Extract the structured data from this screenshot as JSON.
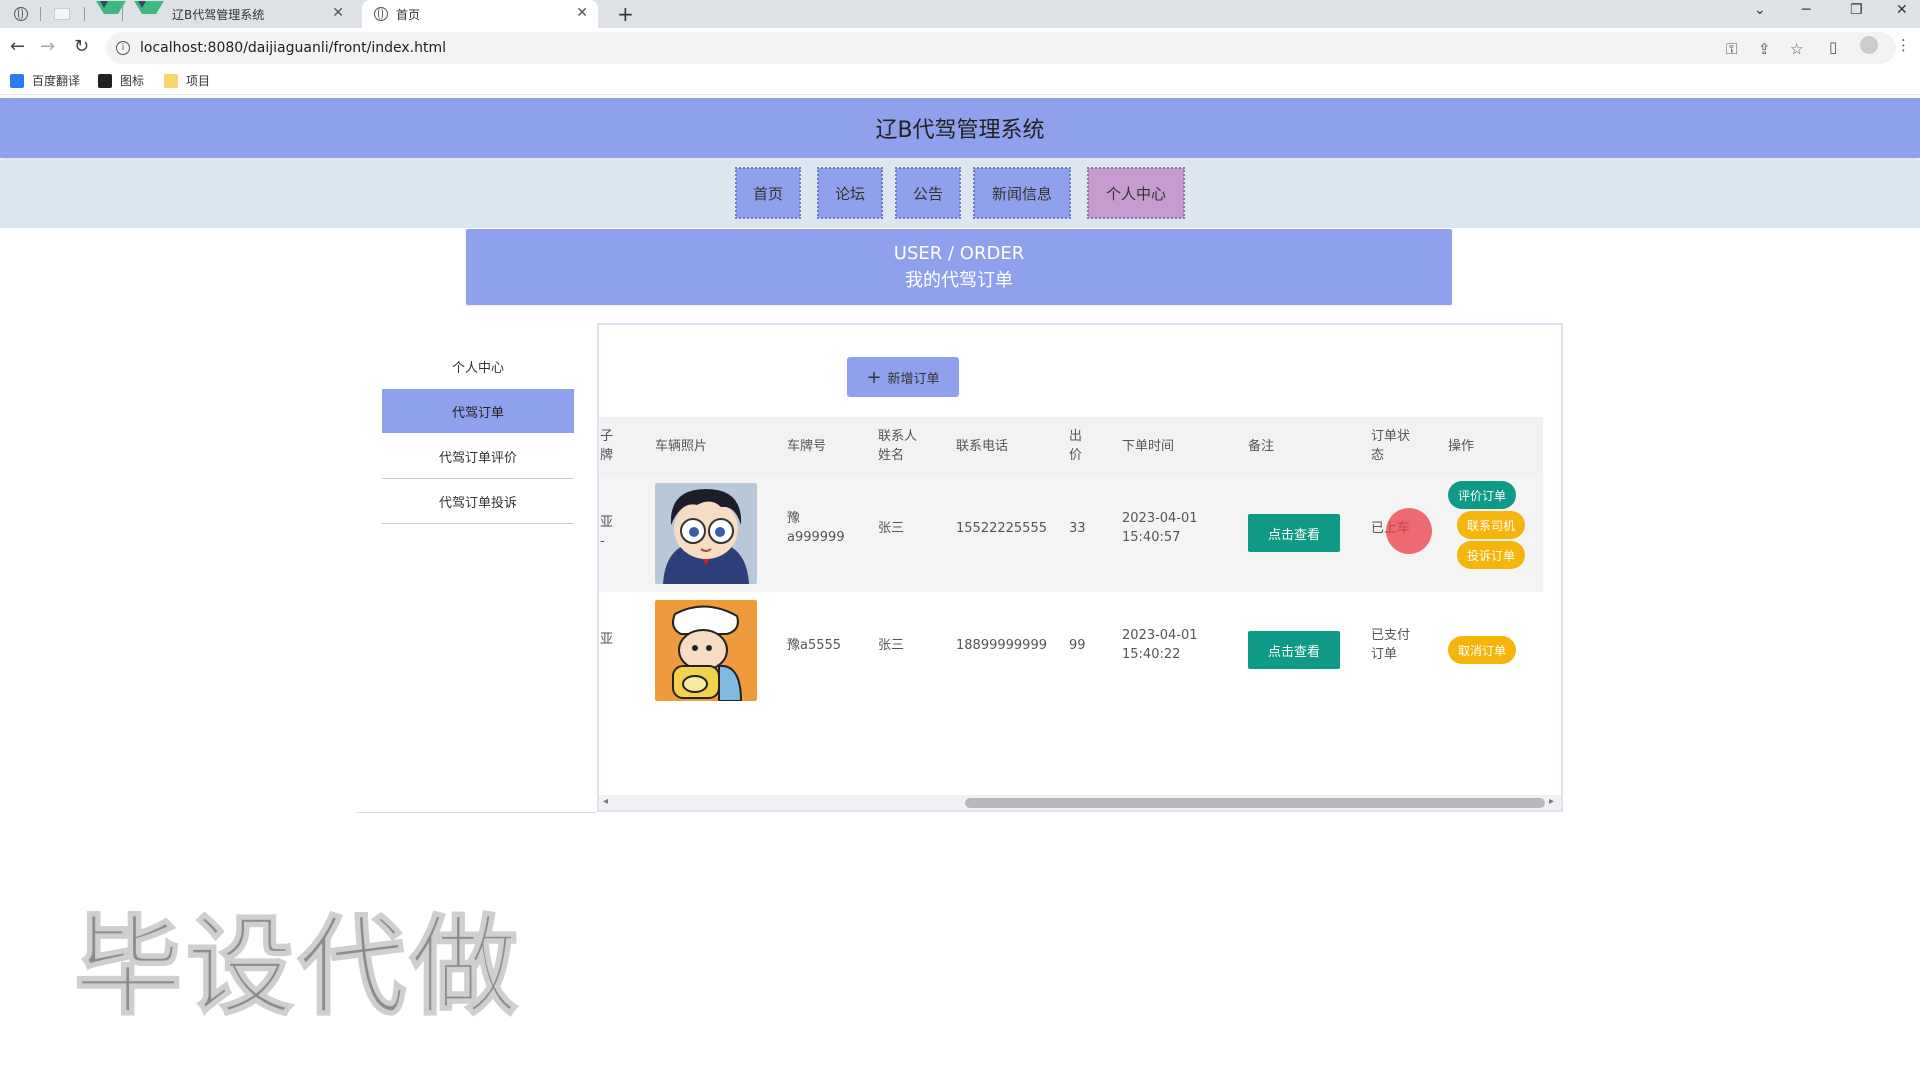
{
  "browser": {
    "tabs": [
      {
        "label": ""
      },
      {
        "label": ""
      },
      {
        "label": ""
      },
      {
        "label": "辽B代驾管理系统"
      },
      {
        "label": "首页"
      }
    ],
    "url": "localhost:8080/daijiaguanli/front/index.html",
    "bookmarks": [
      "百度翻译",
      "图标",
      "项目"
    ]
  },
  "site": {
    "title": "辽B代驾管理系统",
    "nav": [
      "首页",
      "论坛",
      "公告",
      "新闻信息",
      "个人中心"
    ]
  },
  "banner": {
    "en": "USER / ORDER",
    "cn": "我的代驾订单"
  },
  "sidebar": {
    "items": [
      "个人中心",
      "代驾订单",
      "代驾订单评价",
      "代驾订单投诉"
    ]
  },
  "toolbar": {
    "add_label": "新增订单",
    "add_icon": "plus-icon"
  },
  "table": {
    "headers": {
      "partial_col": "子\n牌",
      "photo": "车辆照片",
      "plate": "车牌号",
      "contact_name": "联系人\n姓名",
      "phone": "联系电话",
      "price": "出\n价",
      "order_time": "下单时间",
      "remark": "备注",
      "status": "订单状\n态",
      "action": "操作"
    },
    "rows": [
      {
        "partial_col": "亚\n-",
        "plate": "豫\na999999",
        "contact_name": "张三",
        "phone": "15522225555",
        "price": "33",
        "order_time": "2023-04-01\n15:40:57",
        "remark_btn": "点击查看",
        "status": "已上车",
        "actions": [
          "评价订单",
          "联系司机",
          "投诉订单"
        ]
      },
      {
        "partial_col": "亚",
        "plate": "豫a5555",
        "contact_name": "张三",
        "phone": "18899999999",
        "price": "99",
        "order_time": "2023-04-01\n15:40:22",
        "remark_btn": "点击查看",
        "status": "已支付\n订单",
        "actions": [
          "取消订单"
        ]
      }
    ]
  },
  "watermark": "毕设代做",
  "colors": {
    "primary": "#8fa1ec",
    "nav_active": "#c59bd0",
    "nav_strip": "#dbe6ef",
    "btn_teal": "#0e9a87",
    "btn_orange": "#f5b50c"
  }
}
